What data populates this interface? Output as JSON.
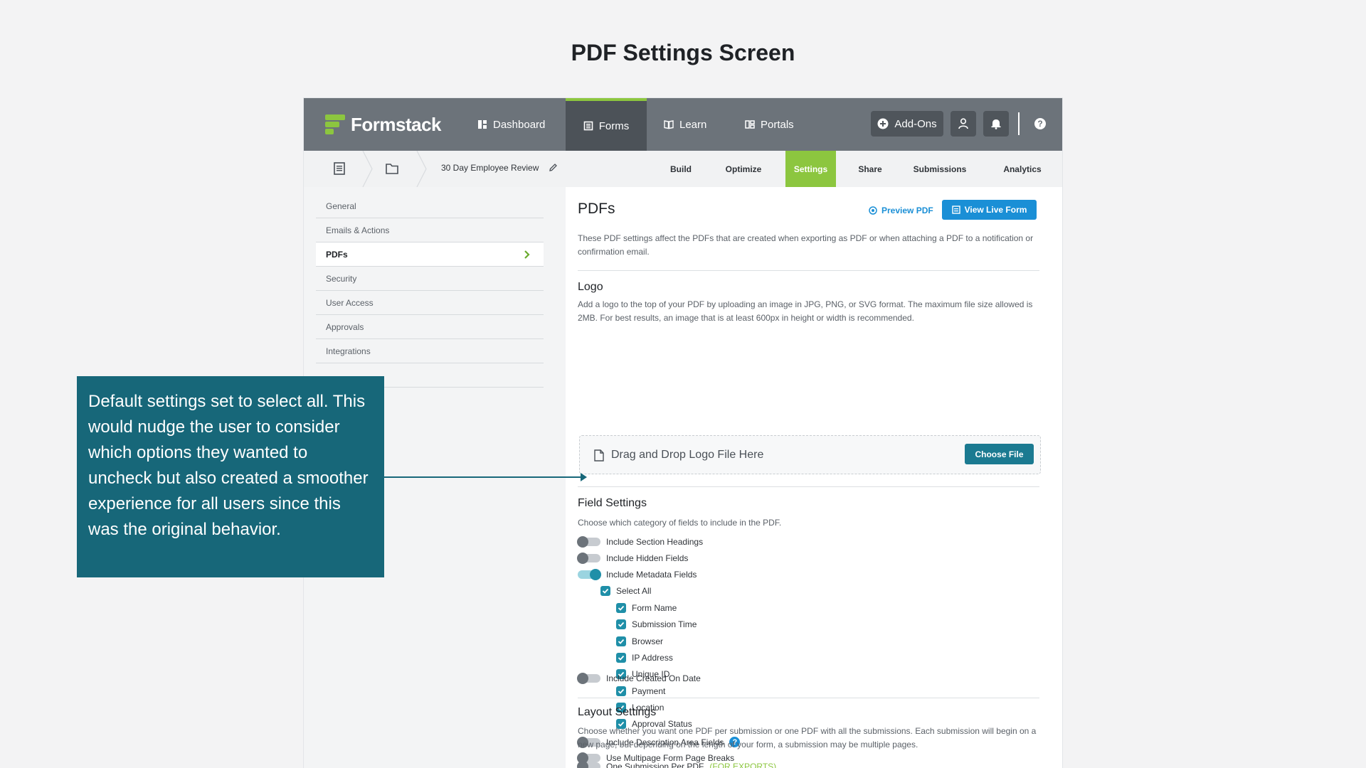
{
  "page_title": "PDF Settings Screen",
  "topnav": {
    "brand": "Formstack",
    "items": [
      {
        "label": "Dashboard",
        "icon": "dashboard-icon"
      },
      {
        "label": "Forms",
        "icon": "forms-icon"
      },
      {
        "label": "Learn",
        "icon": "book-icon"
      },
      {
        "label": "Portals",
        "icon": "portals-icon"
      }
    ],
    "active_item": "Forms",
    "addons_label": "Add-Ons"
  },
  "subnav": {
    "form_name": "30 Day Employee Review",
    "tabs": [
      "Build",
      "Optimize",
      "Settings",
      "Share",
      "Submissions",
      "Analytics"
    ],
    "active_tab": "Settings"
  },
  "sidebar": {
    "items": [
      "General",
      "Emails & Actions",
      "PDFs",
      "Security",
      "User Access",
      "Approvals",
      "Integrations"
    ],
    "active_item": "PDFs"
  },
  "main": {
    "heading": "PDFs",
    "preview_label": "Preview PDF",
    "view_live_label": "View Live Form",
    "intro": "These PDF settings affect the PDFs that are created when exporting as PDF or when attaching a PDF to a notification or confirmation email.",
    "logo": {
      "heading": "Logo",
      "description": "Add a logo to the top of your PDF by uploading an image in JPG, PNG, or SVG format. The maximum file size allowed is 2MB. For best results, an image that is at least 600px in height or width is recommended.",
      "drop_label": "Drag and Drop Logo File Here",
      "choose_label": "Choose File"
    },
    "field_settings": {
      "heading": "Field Settings",
      "description": "Choose which category of fields to include in the PDF.",
      "toggles_top": [
        {
          "label": "Include Section Headings",
          "on": false
        },
        {
          "label": "Include Hidden Fields",
          "on": false
        },
        {
          "label": "Include Metadata Fields",
          "on": true
        }
      ],
      "select_all": "Select All",
      "metadata_options": [
        "Form Name",
        "Submission Time",
        "Browser",
        "IP Address",
        "Unique ID",
        "Payment",
        "Location",
        "Approval Status"
      ],
      "toggles_bottom": [
        {
          "label": "Include Description Area Fields",
          "on": false
        },
        {
          "label": "Use Multipage Form Page Breaks",
          "on": false
        },
        {
          "label": "Include Created On Date",
          "on": false
        }
      ],
      "help_symbol": "?"
    },
    "layout": {
      "heading": "Layout Settings",
      "description": "Choose whether you want one PDF per submission or one PDF with all the submissions. Each submission will begin on a new page, but depending on the length of your form, a submission may be multiple pages.",
      "option_label": "One Submission Per PDF",
      "option_tag": "(FOR EXPORTS)"
    }
  },
  "callout": {
    "text": "Default settings set to select all. This would nudge the user to consider which options they wanted to uncheck but also created a smoother experience for all users since this was the original behavior."
  },
  "colors": {
    "accent_green": "#8cc63f",
    "nav_gray": "#6c737a",
    "link_blue": "#1a8fd6",
    "teal": "#1f8fa8",
    "callout": "#176779"
  }
}
